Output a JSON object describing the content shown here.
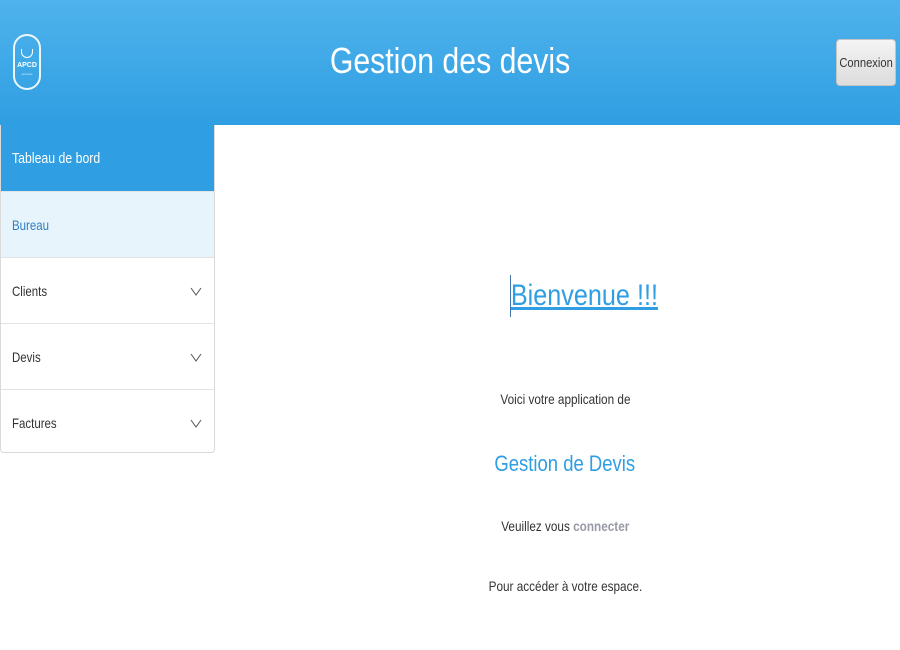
{
  "header": {
    "logo_text": "APCD",
    "logo_subtext": "services",
    "title": "Gestion des devis",
    "login_label": "Connexion"
  },
  "sidebar": {
    "header_label": "Tableau de bord",
    "items": [
      {
        "label": "Bureau",
        "active": true,
        "expandable": false
      },
      {
        "label": "Clients",
        "active": false,
        "expandable": true,
        "icon": "chevron-down-icon"
      },
      {
        "label": "Devis",
        "active": false,
        "expandable": true,
        "icon": "chevron-down-icon"
      },
      {
        "label": "Factures",
        "active": false,
        "expandable": true,
        "icon": "chevron-down-icon"
      }
    ]
  },
  "main": {
    "welcome": "Bienvenue !!!",
    "intro": "Voici votre application de",
    "app_name": "Gestion de Devis",
    "login_prefix": "Veuillez vous",
    "login_link": "connecter",
    "access_text": "Pour accéder à votre espace."
  },
  "colors": {
    "primary": "#2f9ee2",
    "header_gradient_top": "#4fb3ec",
    "active_bg": "#e8f4fc",
    "link_muted": "#999aa8"
  }
}
